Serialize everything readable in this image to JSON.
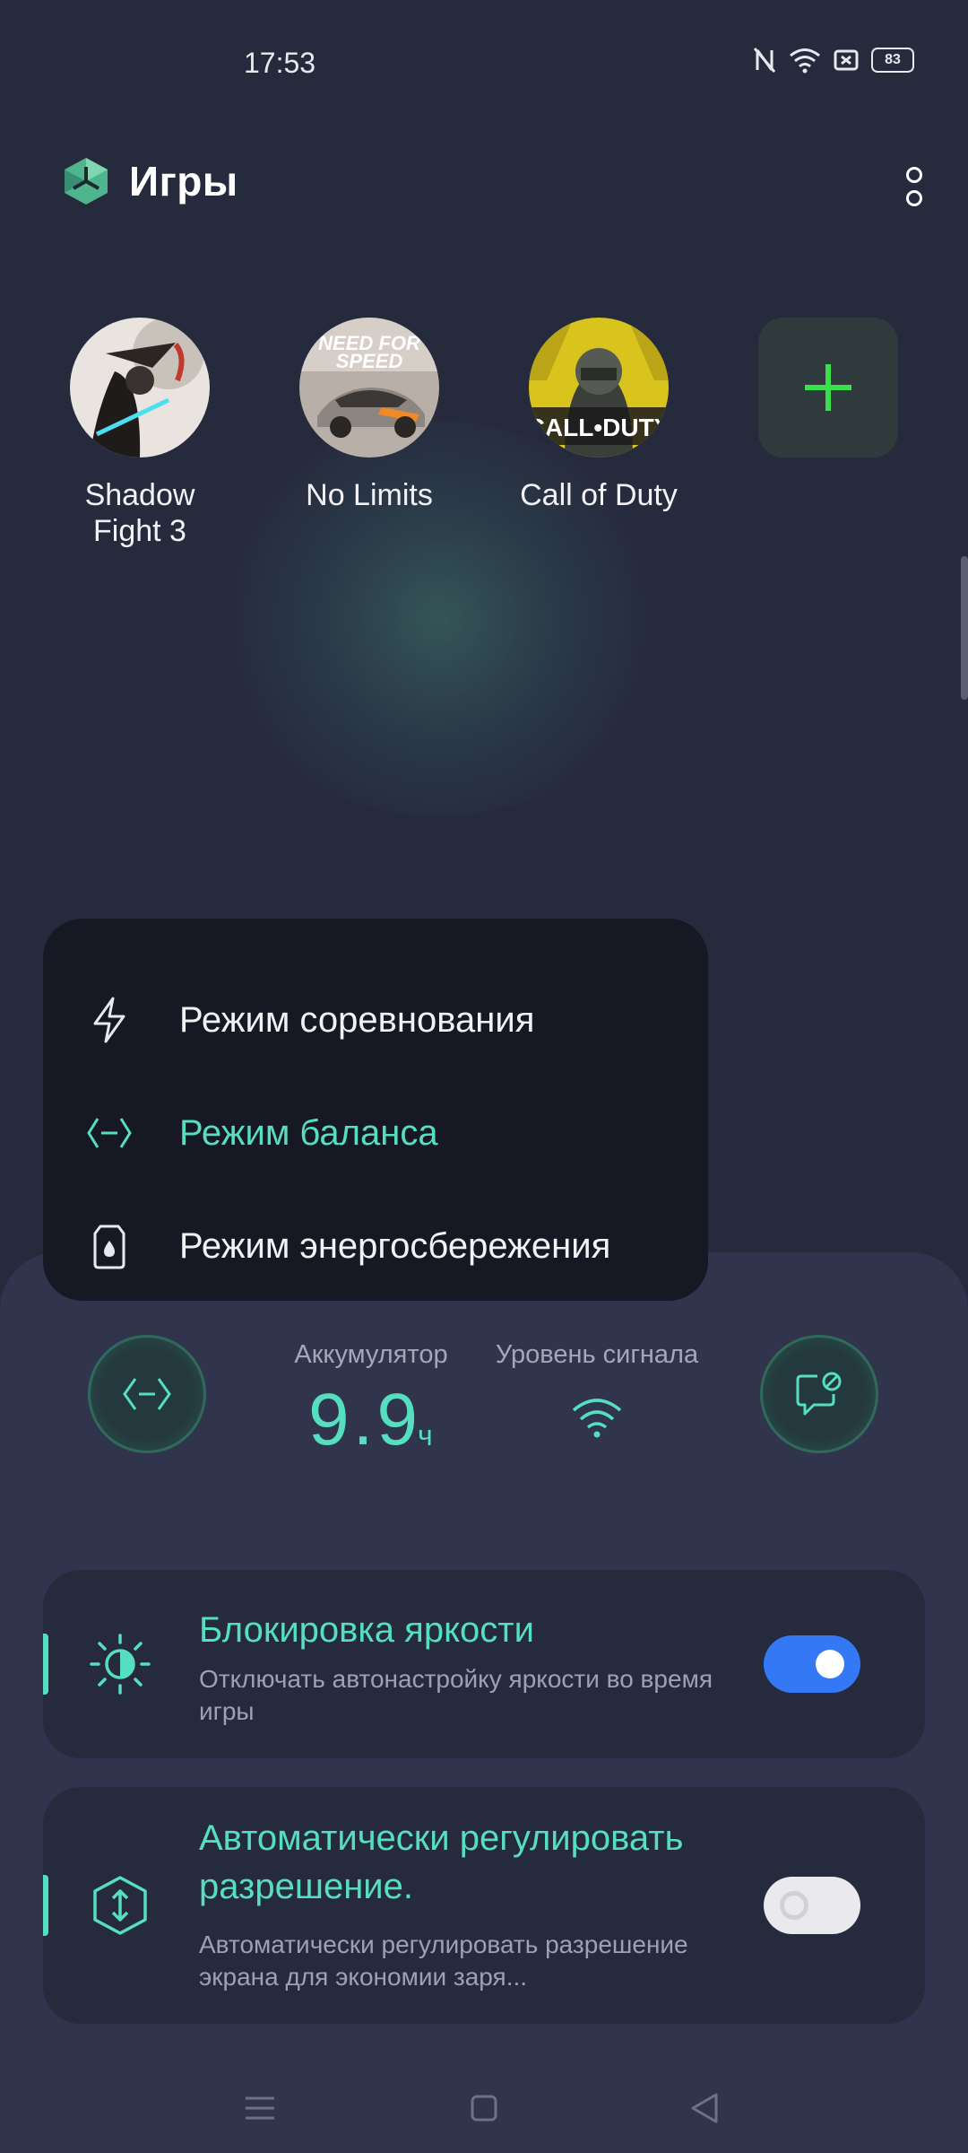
{
  "status_bar": {
    "time": "17:53",
    "battery_level": "83"
  },
  "header": {
    "title": "Игры"
  },
  "games": [
    {
      "name": "Shadow Fight 3",
      "line1": "Shadow",
      "line2": "Fight 3"
    },
    {
      "name": "No Limits",
      "line1": "No Limits",
      "line2": ""
    },
    {
      "name": "Call of Duty",
      "line1": "Call of Duty",
      "line2": ""
    }
  ],
  "mode_menu": {
    "items": [
      {
        "label": "Режим соревнования",
        "icon": "bolt-icon",
        "active": false
      },
      {
        "label": "Режим баланса",
        "icon": "balance-icon",
        "active": true
      },
      {
        "label": "Режим энергосбережения",
        "icon": "power-save-icon",
        "active": false
      }
    ]
  },
  "stats": {
    "battery_label": "Аккумулятор",
    "battery_value": "9.9",
    "battery_unit": "ч",
    "signal_label": "Уровень сигнала"
  },
  "settings": [
    {
      "title": "Блокировка яркости",
      "description": "Отключать автонастройку яркости во время игры",
      "enabled": true,
      "icon": "brightness-icon"
    },
    {
      "title": "Автоматически регулировать разрешение.",
      "description": "Автоматически регулировать разрешение экрана для экономии заря...",
      "enabled": false,
      "icon": "resolution-icon"
    }
  ],
  "colors": {
    "accent": "#55dfc0",
    "toggle_on": "#3478f6",
    "background": "#262a3d",
    "sheet": "#30354d"
  }
}
